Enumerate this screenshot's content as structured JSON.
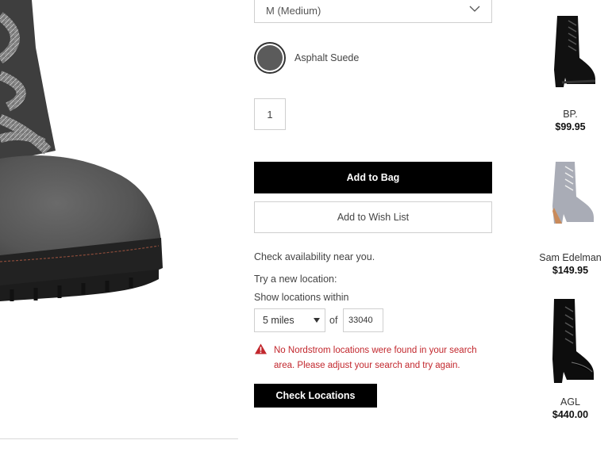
{
  "product": {
    "size_value": "M (Medium)",
    "color_name": "Asphalt Suede",
    "color_hex": "#5b5b5b",
    "quantity": "1",
    "add_to_bag_label": "Add to Bag",
    "add_to_wishlist_label": "Add to Wish List"
  },
  "store_locator": {
    "availability_text": "Check availability near you.",
    "try_location_text": "Try a new location:",
    "show_within_text": "Show locations within",
    "radius_value": "5 miles",
    "of_label": "of",
    "zip_value": "33040",
    "error_text": "No Nordstrom locations were found in your search area. Please adjust your search and try again.",
    "error_color": "#c2272d",
    "check_button_label": "Check Locations"
  },
  "recommendations": [
    {
      "brand": "BP.",
      "price": "$99.95",
      "image": "black-lace-up-heeled-bootie"
    },
    {
      "brand": "Sam Edelman",
      "price": "$149.95",
      "image": "grey-lace-up-heeled-bootie"
    },
    {
      "brand": "AGL",
      "price": "$440.00",
      "image": "black-patent-lace-up-bootie"
    }
  ]
}
